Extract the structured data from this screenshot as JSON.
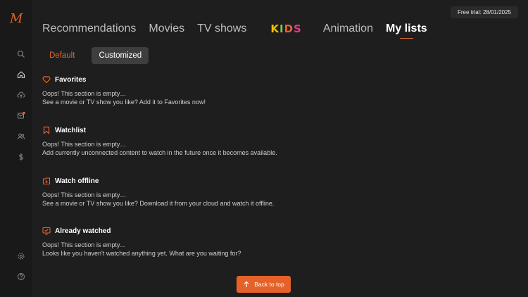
{
  "brand": {
    "logo_letter": "M",
    "accent": "#e4622a"
  },
  "trial": {
    "label": "Free trial: 28/01/2025"
  },
  "sidebar": {
    "icons": [
      "search-icon",
      "home-icon",
      "cloud-upload-icon",
      "messages-icon",
      "users-icon",
      "dollar-icon",
      "settings-icon",
      "help-icon"
    ]
  },
  "nav": {
    "recommendations": "Recommendations",
    "movies": "Movies",
    "tv_shows": "TV shows",
    "kids": "KIDS",
    "animation": "Animation",
    "my_lists": "My lists"
  },
  "subtabs": {
    "default": "Default",
    "customized": "Customized"
  },
  "sections": [
    {
      "title": "Favorites",
      "icon": "heart-icon",
      "line1": "Oops! This section is empty…",
      "line2": "See a movie or TV show you like? Add it to Favorites now!"
    },
    {
      "title": "Watchlist",
      "icon": "bookmark-icon",
      "line1": "Oops! This section is empty…",
      "line2": "Add currently unconnected content to watch in the future once it becomes available."
    },
    {
      "title": "Watch offline",
      "icon": "download-icon",
      "line1": "Oops! This section is empty…",
      "line2": "See a movie or TV show you like? Download it from your cloud and watch it offline."
    },
    {
      "title": "Already watched",
      "icon": "watched-tv-icon",
      "line1": "Oops! This section is empty...",
      "line2": "Looks like you haven't watched anything yet. What are you waiting for?"
    }
  ],
  "back_to_top": {
    "label": "Back to top"
  }
}
